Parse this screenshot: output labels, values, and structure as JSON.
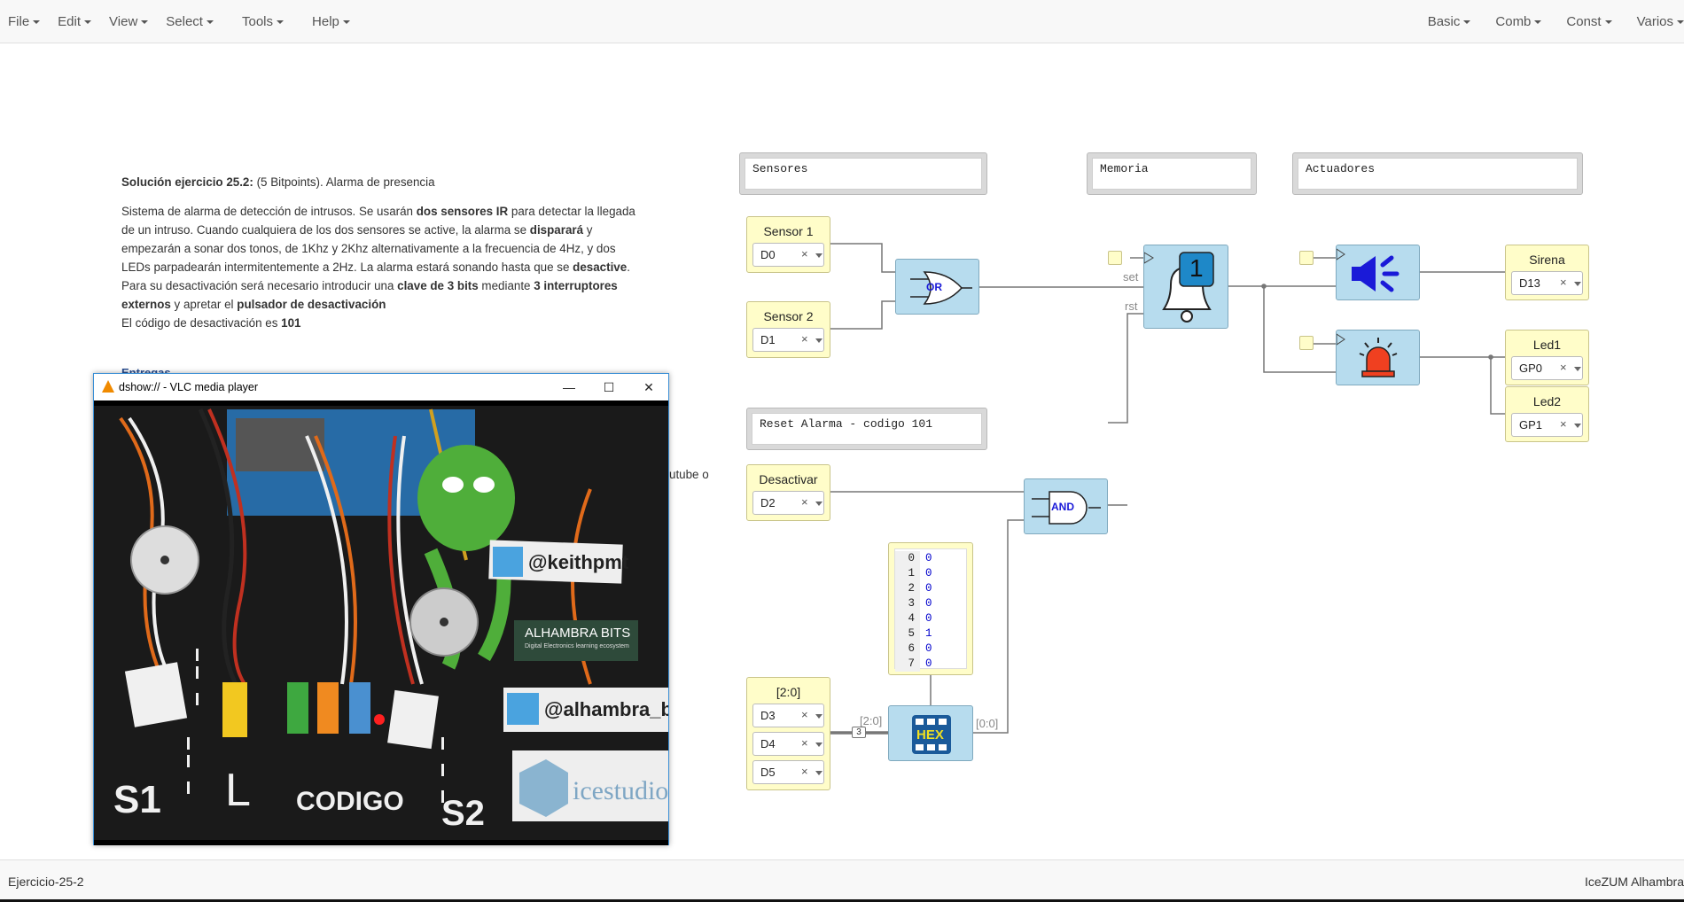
{
  "menubar": {
    "left": [
      "File",
      "Edit",
      "View",
      "Select",
      "Tools",
      "Help"
    ],
    "right": [
      "Basic",
      "Comb",
      "Const",
      "Varios"
    ]
  },
  "description": {
    "heading_bold": "Solución ejercicio 25.2:",
    "heading_rest": " (5 Bitpoints). Alarma de presencia",
    "p1": [
      {
        "t": "Sistema de alarma de detección de intrusos. Se usarán ",
        "b": false
      },
      {
        "t": "dos sensores IR",
        "b": true
      },
      {
        "t": " para detectar la llegada de un intruso. Cuando cualquiera de los dos sensores se active, la alarma se ",
        "b": false
      },
      {
        "t": "disparará",
        "b": true
      },
      {
        "t": " y empezarán a sonar dos tonos, de 1Khz y 2Khz alternativamente a la frecuencia de 4Hz, y dos LEDs parpadearán intermitentemente a 2Hz. La alarma estará sonando hasta que se ",
        "b": false
      },
      {
        "t": "desactive",
        "b": true
      },
      {
        "t": ". Para su desactivación será necesario introducir una ",
        "b": false
      },
      {
        "t": "clave de 3 bits",
        "b": true
      },
      {
        "t": " mediante ",
        "b": false
      },
      {
        "t": "3 interruptores externos",
        "b": true
      },
      {
        "t": " y apretar el ",
        "b": false
      },
      {
        "t": "pulsador de desactivación",
        "b": true
      }
    ],
    "p2_text": "El código de desactivación es ",
    "p2_bold": "101",
    "partial_heading": "Entregas",
    "peek_text": "utube o"
  },
  "notes": {
    "sensores": "Sensores",
    "memoria": "Memoria",
    "actuadores": "Actuadores",
    "reset": "Reset Alarma - codigo 101"
  },
  "inputs": {
    "sensor1": {
      "title": "Sensor 1",
      "pin": "D0"
    },
    "sensor2": {
      "title": "Sensor 2",
      "pin": "D1"
    },
    "desactivar": {
      "title": "Desactivar",
      "pin": "D2"
    },
    "bus": {
      "title": "[2:0]",
      "pins": [
        "D3",
        "D4",
        "D5"
      ]
    }
  },
  "outputs": {
    "sirena": {
      "title": "Sirena",
      "pin": "D13"
    },
    "led1": {
      "title": "Led1",
      "pin": "GP0"
    },
    "led2": {
      "title": "Led2",
      "pin": "GP1"
    }
  },
  "gates": {
    "or": "OR",
    "and": "AND",
    "hex": "HEX"
  },
  "memory_block": {
    "value": "1"
  },
  "wire_labels": {
    "set": "set",
    "rst": "rst",
    "bus_in": "[2:0]",
    "bus_out": "[0:0]",
    "bus_width": "3"
  },
  "memtable": {
    "rows": [
      {
        "addr": "0",
        "val": "0"
      },
      {
        "addr": "1",
        "val": "0"
      },
      {
        "addr": "2",
        "val": "0"
      },
      {
        "addr": "3",
        "val": "0"
      },
      {
        "addr": "4",
        "val": "0"
      },
      {
        "addr": "5",
        "val": "1"
      },
      {
        "addr": "6",
        "val": "0"
      },
      {
        "addr": "7",
        "val": "0"
      }
    ]
  },
  "vlc": {
    "title": "dshow:// - VLC media player",
    "minimize": "—",
    "maximize": "☐",
    "close": "✕",
    "video_text": [
      "@keithpmt",
      "ALHAMBRA BITS",
      "Digital Electronics learning ecosystem",
      "@alhambra_bits",
      "icestudio",
      "S1",
      "L",
      "CODIGO",
      "S2"
    ]
  },
  "statusbar": {
    "left": "Ejercicio-25-2",
    "right": "IceZUM Alhambra"
  },
  "colors": {
    "block_blue": "#b7dcee",
    "io_yellow": "#fffdc9",
    "wire": "#777777",
    "bell_fill": "#1e88c8",
    "speaker": "#1a1ad8",
    "siren_red": "#f04020"
  }
}
